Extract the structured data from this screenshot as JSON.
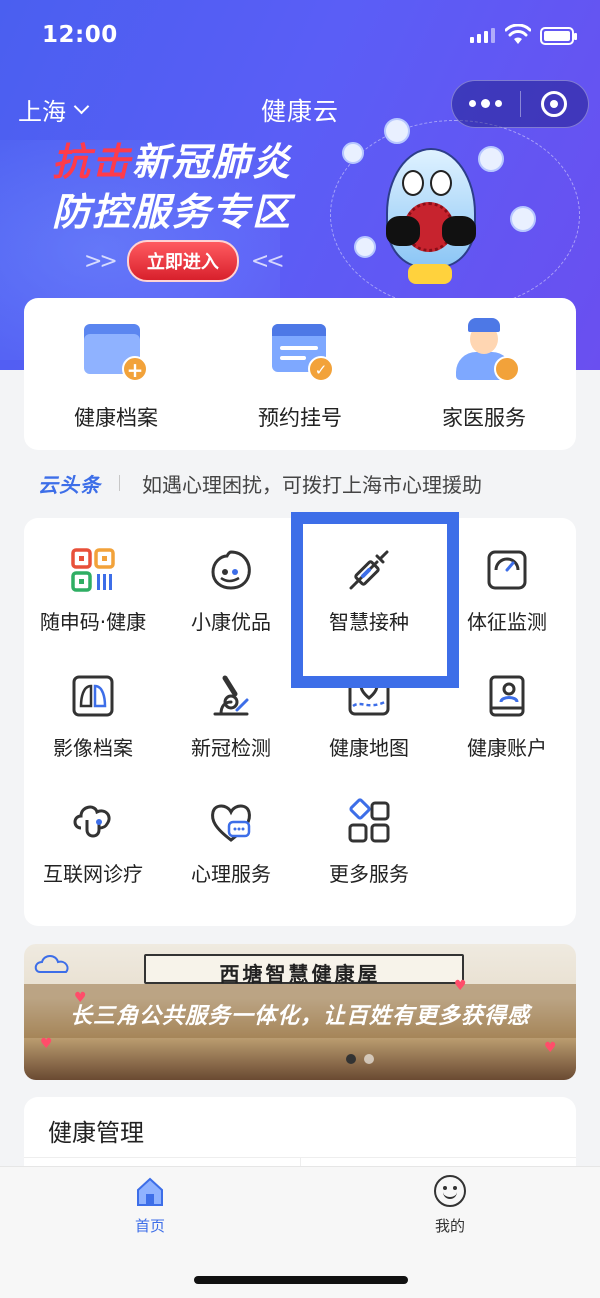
{
  "status_bar": {
    "time": "12:00"
  },
  "nav": {
    "city": "上海",
    "title": "健康云"
  },
  "hero": {
    "line1_red": "抗击",
    "line1_rest": "新冠肺炎",
    "line2": "防控服务专区",
    "enter_label": "立即进入",
    "arrows_left": ">>",
    "arrows_right": "<<"
  },
  "quick_services": [
    {
      "label": "健康档案",
      "icon": "folder-plus-icon"
    },
    {
      "label": "预约挂号",
      "icon": "calendar-check-icon"
    },
    {
      "label": "家医服务",
      "icon": "doctor-icon"
    }
  ],
  "ticker": {
    "brand": "云头条",
    "message": "如遇心理困扰，可拨打上海市心理援助"
  },
  "services": [
    {
      "label": "随申码·健康",
      "icon": "qr-code-icon"
    },
    {
      "label": "小康优品",
      "icon": "mascot-face-icon"
    },
    {
      "label": "智慧接种",
      "icon": "syringe-icon"
    },
    {
      "label": "体征监测",
      "icon": "gauge-icon"
    },
    {
      "label": "影像档案",
      "icon": "lungs-icon"
    },
    {
      "label": "新冠检测",
      "icon": "microscope-icon"
    },
    {
      "label": "健康地图",
      "icon": "map-pin-icon"
    },
    {
      "label": "健康账户",
      "icon": "account-book-icon"
    },
    {
      "label": "互联网诊疗",
      "icon": "cloud-stethoscope-icon"
    },
    {
      "label": "心理服务",
      "icon": "heart-chat-icon"
    },
    {
      "label": "更多服务",
      "icon": "more-grid-icon"
    }
  ],
  "promo": {
    "store_name": "西塘智慧健康屋",
    "slogan": "长三角公共服务一体化，让百姓有更多获得感"
  },
  "health_mgmt": {
    "title": "健康管理"
  },
  "tabbar": {
    "home": "首页",
    "me": "我的",
    "active_color": "#3d6ee8"
  },
  "colors": {
    "accent": "#3d6ee8",
    "badge": "#f2a23a",
    "hero_red": "#ff3b4a"
  }
}
